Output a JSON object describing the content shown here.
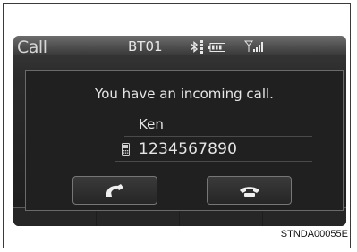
{
  "screen": {
    "title": "Call",
    "device_name": "BT01",
    "status_icons": [
      "bluetooth-icon",
      "bluetooth-signal-level-icon",
      "battery-icon",
      "cellular-signal-icon"
    ]
  },
  "incoming_call": {
    "message": "You have an incoming call.",
    "caller_name": "Ken",
    "phone_number": "1234567890",
    "number_icon": "mobile-phone-icon"
  },
  "buttons": {
    "answer": "phone-pickup-icon",
    "decline": "phone-hangup-icon"
  },
  "caption": "STNDA00055E"
}
